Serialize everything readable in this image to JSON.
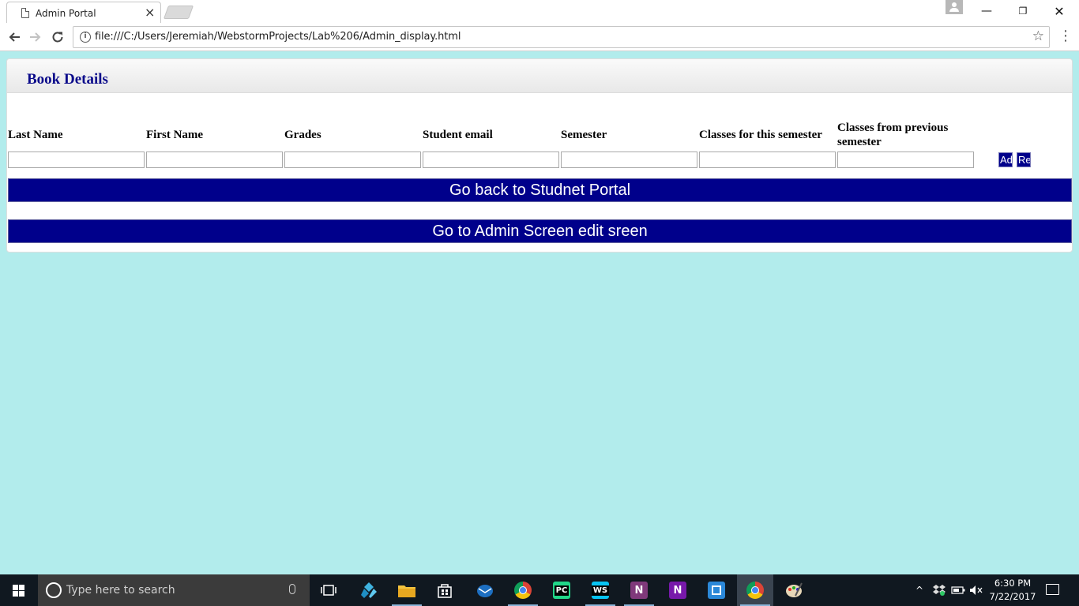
{
  "browser": {
    "tab_title": "Admin Portal",
    "tab_close": "×",
    "url": "file:///C:/Users/Jeremiah/WebstormProjects/Lab%206/Admin_display.html",
    "back_icon": "back-arrow-icon",
    "forward_icon": "forward-arrow-icon",
    "reload_icon": "reload-icon",
    "star_icon": "star-icon",
    "menu_icon": "kebab-menu-icon",
    "window": {
      "minimize": "—",
      "maximize": "❐",
      "close": "✕"
    }
  },
  "page": {
    "background": "#b2ecec",
    "accent": "#00008b",
    "panel_title": "Book Details",
    "columns": [
      {
        "label": "Last Name",
        "value": ""
      },
      {
        "label": "First Name",
        "value": ""
      },
      {
        "label": "Grades",
        "value": ""
      },
      {
        "label": "Student email",
        "value": ""
      },
      {
        "label": "Semester",
        "value": ""
      },
      {
        "label": "Classes for this semester",
        "value": ""
      },
      {
        "label": "Classes from previous semester",
        "value": ""
      }
    ],
    "add_button": "Add",
    "remove_button": "Remove",
    "back_button": "Go back to Studnet Portal",
    "admin_button": "Go to Admin Screen edit sreen"
  },
  "taskbar": {
    "search_placeholder": "Type here to search",
    "apps": [
      "task-view-icon",
      "kodi-icon",
      "file-explorer-icon",
      "store-icon",
      "thunderbird-icon",
      "chrome-icon",
      "pycharm-icon",
      "webstorm-icon",
      "onenote-icon",
      "onenote-2016-icon",
      "remote-desktop-icon",
      "chrome-active-icon",
      "paint-icon"
    ],
    "clock_time": "6:30 PM",
    "clock_date": "7/22/2017"
  }
}
